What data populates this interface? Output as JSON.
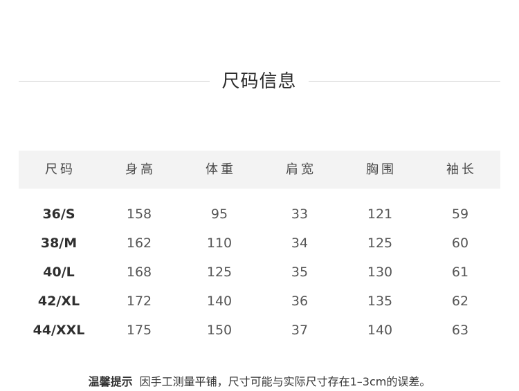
{
  "title": "尺码信息",
  "table": {
    "headers": [
      "尺码",
      "身高",
      "体重",
      "肩宽",
      "胸围",
      "袖长"
    ],
    "rows": [
      [
        "36/S",
        "158",
        "95",
        "33",
        "121",
        "59"
      ],
      [
        "38/M",
        "162",
        "110",
        "34",
        "125",
        "60"
      ],
      [
        "40/L",
        "168",
        "125",
        "35",
        "130",
        "61"
      ],
      [
        "42/XL",
        "172",
        "140",
        "36",
        "135",
        "62"
      ],
      [
        "44/XXL",
        "175",
        "150",
        "37",
        "140",
        "63"
      ]
    ]
  },
  "tip": {
    "label": "温馨提示",
    "text": "因手工测量平铺，尺寸可能与实际尺寸存在1–3cm的误差。"
  }
}
